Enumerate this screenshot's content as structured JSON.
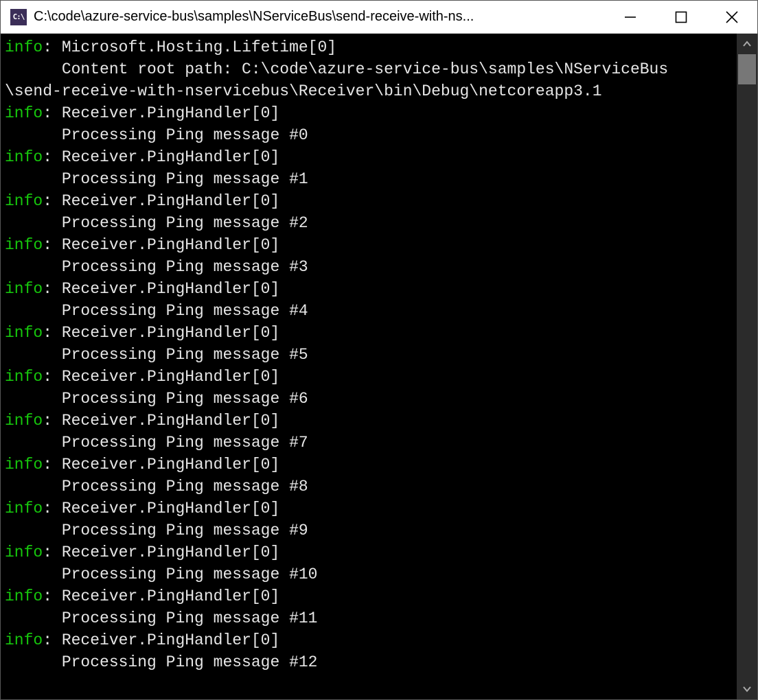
{
  "window": {
    "title": "C:\\code\\azure-service-bus\\samples\\NServiceBus\\send-receive-with-ns...",
    "icon_text": "C:\\"
  },
  "log": {
    "label": "info",
    "lines": [
      {
        "level": "info",
        "source": "Microsoft.Hosting.Lifetime[0]"
      },
      {
        "cont": "      Content root path: C:\\code\\azure-service-bus\\samples\\NServiceBus"
      },
      {
        "raw": "\\send-receive-with-nservicebus\\Receiver\\bin\\Debug\\netcoreapp3.1"
      },
      {
        "level": "info",
        "source": "Receiver.PingHandler[0]"
      },
      {
        "cont": "      Processing Ping message #0"
      },
      {
        "level": "info",
        "source": "Receiver.PingHandler[0]"
      },
      {
        "cont": "      Processing Ping message #1"
      },
      {
        "level": "info",
        "source": "Receiver.PingHandler[0]"
      },
      {
        "cont": "      Processing Ping message #2"
      },
      {
        "level": "info",
        "source": "Receiver.PingHandler[0]"
      },
      {
        "cont": "      Processing Ping message #3"
      },
      {
        "level": "info",
        "source": "Receiver.PingHandler[0]"
      },
      {
        "cont": "      Processing Ping message #4"
      },
      {
        "level": "info",
        "source": "Receiver.PingHandler[0]"
      },
      {
        "cont": "      Processing Ping message #5"
      },
      {
        "level": "info",
        "source": "Receiver.PingHandler[0]"
      },
      {
        "cont": "      Processing Ping message #6"
      },
      {
        "level": "info",
        "source": "Receiver.PingHandler[0]"
      },
      {
        "cont": "      Processing Ping message #7"
      },
      {
        "level": "info",
        "source": "Receiver.PingHandler[0]"
      },
      {
        "cont": "      Processing Ping message #8"
      },
      {
        "level": "info",
        "source": "Receiver.PingHandler[0]"
      },
      {
        "cont": "      Processing Ping message #9"
      },
      {
        "level": "info",
        "source": "Receiver.PingHandler[0]"
      },
      {
        "cont": "      Processing Ping message #10"
      },
      {
        "level": "info",
        "source": "Receiver.PingHandler[0]"
      },
      {
        "cont": "      Processing Ping message #11"
      },
      {
        "level": "info",
        "source": "Receiver.PingHandler[0]"
      },
      {
        "cont": "      Processing Ping message #12"
      }
    ]
  }
}
